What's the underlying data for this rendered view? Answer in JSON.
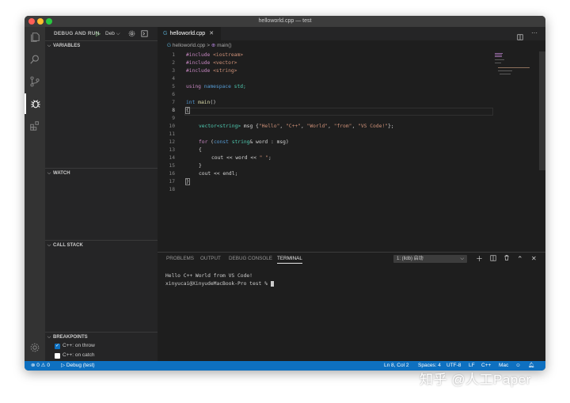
{
  "window": {
    "title": "helloworld.cpp — test"
  },
  "sidebar": {
    "title": "DEBUG AND RUN",
    "config": "Deb",
    "sections": {
      "variables": "VARIABLES",
      "watch": "WATCH",
      "call_stack": "CALL STACK",
      "breakpoints": "BREAKPOINTS"
    },
    "breakpoints": [
      {
        "label": "C++: on throw",
        "checked": true
      },
      {
        "label": "C++: on catch",
        "checked": false
      }
    ]
  },
  "editor": {
    "tab": "helloworld.cpp",
    "breadcrumb": {
      "file": "helloworld.cpp",
      "symbol": "main()"
    },
    "line_numbers": [
      "1",
      "2",
      "3",
      "4",
      "5",
      "6",
      "7",
      "8",
      "9",
      "10",
      "11",
      "12",
      "13",
      "14",
      "15",
      "16",
      "17",
      "18"
    ],
    "code": {
      "l1_a": "#include ",
      "l1_b": "<iostream>",
      "l2_a": "#include ",
      "l2_b": "<vector>",
      "l3_a": "#include ",
      "l3_b": "<string>",
      "l5_a": "using ",
      "l5_b": "namespace ",
      "l5_c": "std;",
      "l7_a": "int ",
      "l7_b": "main",
      "l7_c": "()",
      "l8": "{",
      "l10_a": "vector",
      "l10_b": "<string>",
      "l10_c": " msg {",
      "l10_d": "\"Hello\"",
      "l10_e": ", ",
      "l10_f": "\"C++\"",
      "l10_g": ", ",
      "l10_h": "\"World\"",
      "l10_i": ", ",
      "l10_j": "\"from\"",
      "l10_k": ", ",
      "l10_l": "\"VS Code!\"",
      "l10_m": "};",
      "l12_a": "for ",
      "l12_b": "(",
      "l12_c": "const ",
      "l12_d": "string",
      "l12_e": "& word : msg)",
      "l13": "{",
      "l14_a": "cout << word << ",
      "l14_b": "\" \"",
      "l14_c": ";",
      "l15": "}",
      "l16": "cout << endl;",
      "l17": "}"
    }
  },
  "panel": {
    "tabs": [
      "PROBLEMS",
      "OUTPUT",
      "DEBUG CONSOLE",
      "TERMINAL"
    ],
    "terminal_select": "1: (lldb) 启动",
    "terminal_lines": [
      "Hello C++ World from VS Code!",
      "xinyucai@XinyudeMacBook-Pro test % "
    ]
  },
  "statusbar": {
    "errors": "0",
    "warnings": "0",
    "debug": "Debug (test)",
    "position": "Ln 8, Col 2",
    "spaces": "Spaces: 4",
    "encoding": "UTF-8",
    "eol": "LF",
    "language": "C++",
    "platform": "Mac"
  },
  "watermark": "知乎 @人工Paper",
  "colors": {
    "statusbar": "#0e70c0",
    "editor_bg": "#1e1e1e",
    "sidebar_bg": "#252526",
    "activity_bg": "#333333"
  }
}
